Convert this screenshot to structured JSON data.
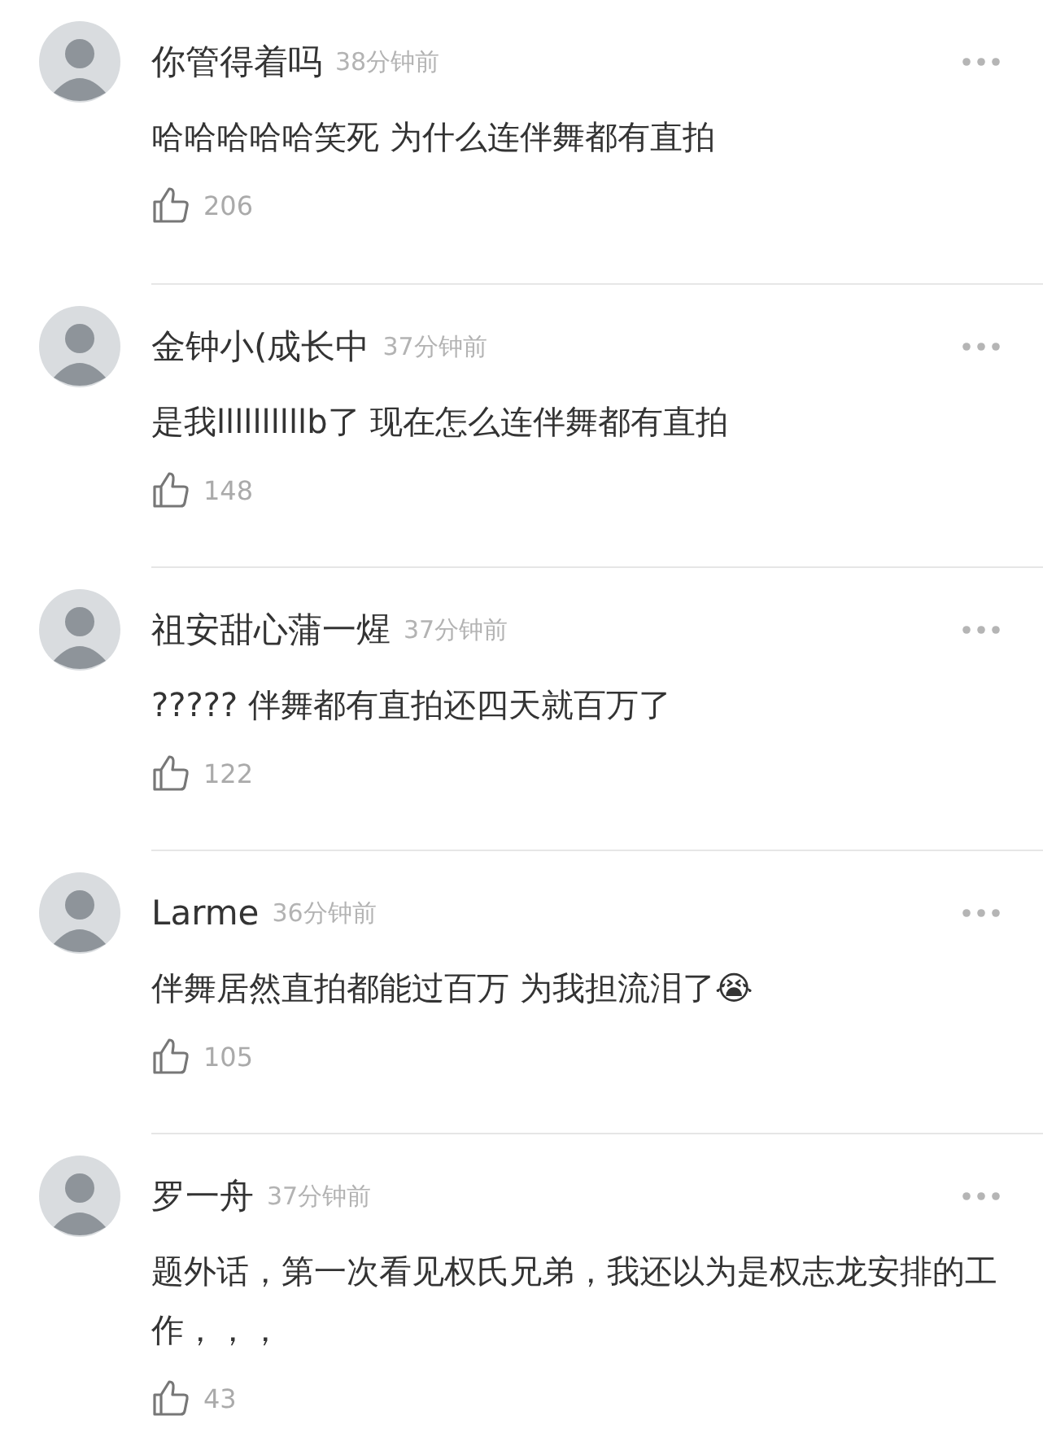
{
  "comments": [
    {
      "name": "你管得着吗",
      "time": "38分钟前",
      "text": "哈哈哈哈哈笑死 为什么连伴舞都有直拍",
      "likes": "206"
    },
    {
      "name": "金钟小(成长中",
      "time": "37分钟前",
      "text": "是我llllllllllb了 现在怎么连伴舞都有直拍",
      "likes": "148"
    },
    {
      "name": "祖安甜心蒲一煋",
      "time": "37分钟前",
      "text": "????? 伴舞都有直拍还四天就百万了",
      "likes": "122"
    },
    {
      "name": "Larme",
      "time": "36分钟前",
      "text": "伴舞居然直拍都能过百万 为我担流泪了😭",
      "likes": "105"
    },
    {
      "name": "罗一舟",
      "time": "37分钟前",
      "text": "题外话，第一次看见权氏兄弟，我还以为是权志龙安排的工作，，，",
      "likes": "43"
    }
  ]
}
